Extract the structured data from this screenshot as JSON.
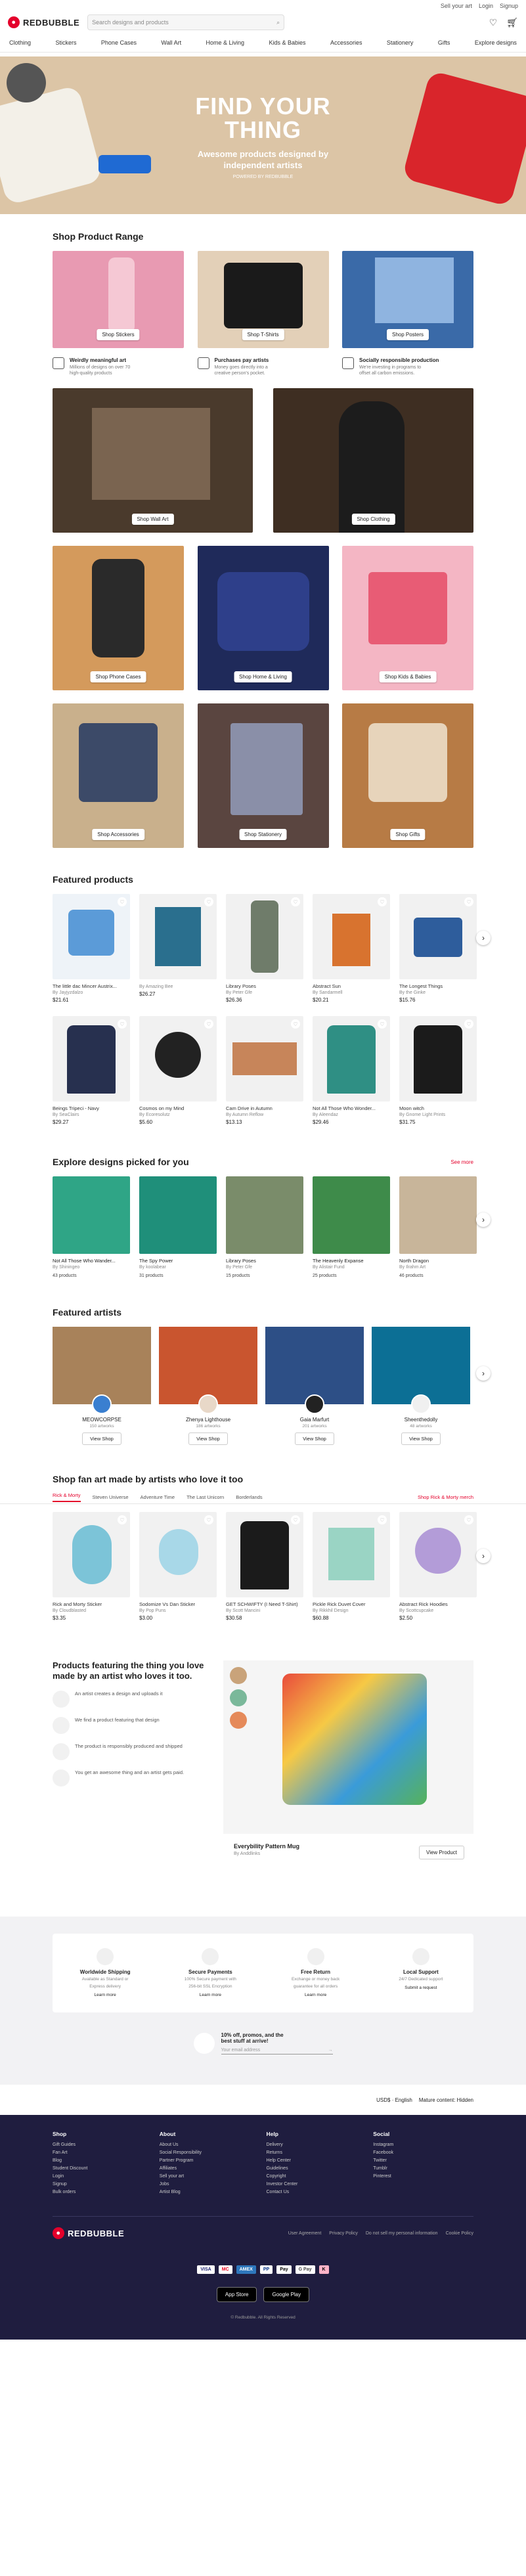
{
  "topbar": {
    "links": [
      "Sell your art",
      "Login",
      "Signup"
    ]
  },
  "header": {
    "logo": "REDBUBBLE",
    "search_placeholder": "Search designs and products"
  },
  "nav": [
    "Clothing",
    "Stickers",
    "Phone Cases",
    "Wall Art",
    "Home & Living",
    "Kids & Babies",
    "Accessories",
    "Stationery",
    "Gifts",
    "Explore designs"
  ],
  "hero": {
    "title_line1": "FIND YOUR",
    "title_line2": "THING",
    "subtitle_line1": "Awesome products designed by",
    "subtitle_line2": "independent artists",
    "powered": "POWERED BY REDBUBBLE"
  },
  "shop_range": {
    "title": "Shop Product Range",
    "row1": [
      {
        "label": "Shop Stickers"
      },
      {
        "label": "Shop T-Shirts"
      },
      {
        "label": "Shop Posters"
      }
    ],
    "usps": [
      {
        "title": "Weirdly meaningful art",
        "text_line1": "Millions of designs on over 70",
        "text_line2": "high-quality products"
      },
      {
        "title": "Purchases pay artists",
        "text_line1": "Money goes directly into a",
        "text_line2": "creative person's pocket."
      },
      {
        "title": "Socially responsible production",
        "text_line1": "We're investing in programs to",
        "text_line2": "offset all carbon emissions."
      }
    ],
    "row2": [
      {
        "label": "Shop Wall Art"
      },
      {
        "label": "Shop Clothing"
      }
    ],
    "row3": [
      {
        "label": "Shop Phone Cases"
      },
      {
        "label": "Shop Home & Living"
      },
      {
        "label": "Shop Kids & Babies"
      }
    ],
    "row4": [
      {
        "label": "Shop Accessories"
      },
      {
        "label": "Shop Stationery"
      },
      {
        "label": "Shop Gifts"
      }
    ]
  },
  "featured": {
    "title": "Featured products",
    "row1": [
      {
        "title": "The little dac Mincer Austrix...",
        "artist": "By Jayjyzdalzo",
        "price": "$21.61"
      },
      {
        "title": "",
        "artist": "By Amazing Bee",
        "price": "$26.27"
      },
      {
        "title": "Library Poses",
        "artist": "By Peter Gfe",
        "price": "$26.36"
      },
      {
        "title": "Abstract Sun",
        "artist": "By Sandarmell",
        "price": "$20.21"
      },
      {
        "title": "The Longest Things",
        "artist": "By the Ginke",
        "price": "$15.76"
      }
    ],
    "row2": [
      {
        "title": "Beings Tripeci - Navy",
        "artist": "By SeaClairs",
        "price": "$29.27"
      },
      {
        "title": "Cosmos on my Mind",
        "artist": "By Ecoresolutz",
        "price": "$5.60"
      },
      {
        "title": "Cam Drive in Autumn",
        "artist": "By Autumn Reflow",
        "price": "$13.13"
      },
      {
        "title": "Not All Those Who Wonder...",
        "artist": "By Aleendaz",
        "price": "$29.46"
      },
      {
        "title": "Moon witch",
        "artist": "By Gnome Light Prints",
        "price": "$31.75"
      }
    ]
  },
  "explore": {
    "title": "Explore designs picked for you",
    "see_more": "See more",
    "items": [
      {
        "title": "Not All Those Who Wander...",
        "artist": "By Shiningeo",
        "count": "43 products"
      },
      {
        "title": "The Spy Power",
        "artist": "By koolabear",
        "count": "31 products"
      },
      {
        "title": "Library Poses",
        "artist": "By Peter Gfe",
        "count": "15 products"
      },
      {
        "title": "The Heavenly Expanse",
        "artist": "By Alistair Fund",
        "count": "25 products"
      },
      {
        "title": "North Dragon",
        "artist": "By Ilrahm Art",
        "count": "46 products"
      }
    ]
  },
  "artists": {
    "title": "Featured artists",
    "items": [
      {
        "name": "MEOWCORPSE",
        "works": "150 artworks",
        "btn": "View Shop"
      },
      {
        "name": "Zhenya Lighthouse",
        "works": "186 artworks",
        "btn": "View Shop"
      },
      {
        "name": "Gaia Marfurt",
        "works": "201 artworks",
        "btn": "View Shop"
      },
      {
        "name": "Sheenthedolly",
        "works": "48 artworks",
        "btn": "View Shop"
      }
    ]
  },
  "fanart": {
    "title": "Shop fan art made by artists who love it too",
    "tabs": [
      "Rick & Morty",
      "Steven Universe",
      "Adventure Time",
      "The Last Unicorn",
      "Borderlands"
    ],
    "shop_link": "Shop Rick & Morty merch",
    "items": [
      {
        "title": "Rick and Morty Sticker",
        "artist": "By Cloudblasted",
        "price": "$3.35"
      },
      {
        "title": "Sodomize Vs Dan Sticker",
        "artist": "By Pop Puns",
        "price": "$3.00"
      },
      {
        "title": "GET SCHWIFTY (I Need T-Shirt)",
        "artist": "By Scott Mancini",
        "price": "$30.58"
      },
      {
        "title": "Pickle Rick Duvet Cover",
        "artist": "By Rikkhil Design",
        "price": "$60.88"
      },
      {
        "title": "Abstract Rick Hoodies",
        "artist": "By Scottcupcake",
        "price": "$2.50"
      }
    ]
  },
  "feature_block": {
    "heading": "Products featuring the thing you love made by an artist who loves it too.",
    "steps": [
      "An artist creates a design and uploads it",
      "We find a product featuring that design",
      "The product is responsibly produced and shipped",
      "You get an awesome thing and an artist gets paid."
    ],
    "product_title": "Everybility Pattern Mug",
    "product_artist": "By Anddlinks",
    "btn": "View Product"
  },
  "trust": [
    {
      "title": "Worldwide Shipping",
      "line1": "Available as Standard or",
      "line2": "Express delivery",
      "link": "Learn more"
    },
    {
      "title": "Secure Payments",
      "line1": "100% Secure payment with",
      "line2": "256-bit SSL Encryption",
      "link": "Learn more"
    },
    {
      "title": "Free Return",
      "line1": "Exchange or money back",
      "line2": "guarantee for all orders",
      "link": "Learn more"
    },
    {
      "title": "Local Support",
      "line1": "24/7 Dedicated support",
      "line2": "",
      "link": "Submit a request"
    }
  ],
  "newsletter": {
    "line1": "10% off, promos, and the",
    "line2": "best stuff at arrive!",
    "placeholder": "Your email address"
  },
  "locale": {
    "currency": "USD$",
    "language": "English",
    "mature": "Mature content: Hidden"
  },
  "footer": {
    "columns": [
      {
        "title": "Shop",
        "links": [
          "Gift Guides",
          "Fan Art",
          "Blog",
          "Student Discount",
          "Login",
          "Signup",
          "Bulk orders"
        ]
      },
      {
        "title": "About",
        "links": [
          "About Us",
          "Social Responsibility",
          "Partner Program",
          "Affiliates",
          "Sell your art",
          "Jobs",
          "Artist Blog"
        ]
      },
      {
        "title": "Help",
        "links": [
          "Delivery",
          "Returns",
          "Help Center",
          "Guidelines",
          "Copyright",
          "Investor Center",
          "Contact Us"
        ]
      },
      {
        "title": "Social",
        "links": [
          "Instagram",
          "Facebook",
          "Twitter",
          "Tumblr",
          "Pinterest"
        ]
      }
    ],
    "legal": [
      "User Agreement",
      "Privacy Policy",
      "Do not sell my personal information",
      "Cookie Policy"
    ],
    "payments": [
      "VISA",
      "MC",
      "AMEX",
      "PP",
      "Pay",
      "G Pay",
      "K"
    ],
    "apps": [
      "App Store",
      "Google Play"
    ],
    "copyright": "© Redbubble. All Rights Reserved"
  }
}
